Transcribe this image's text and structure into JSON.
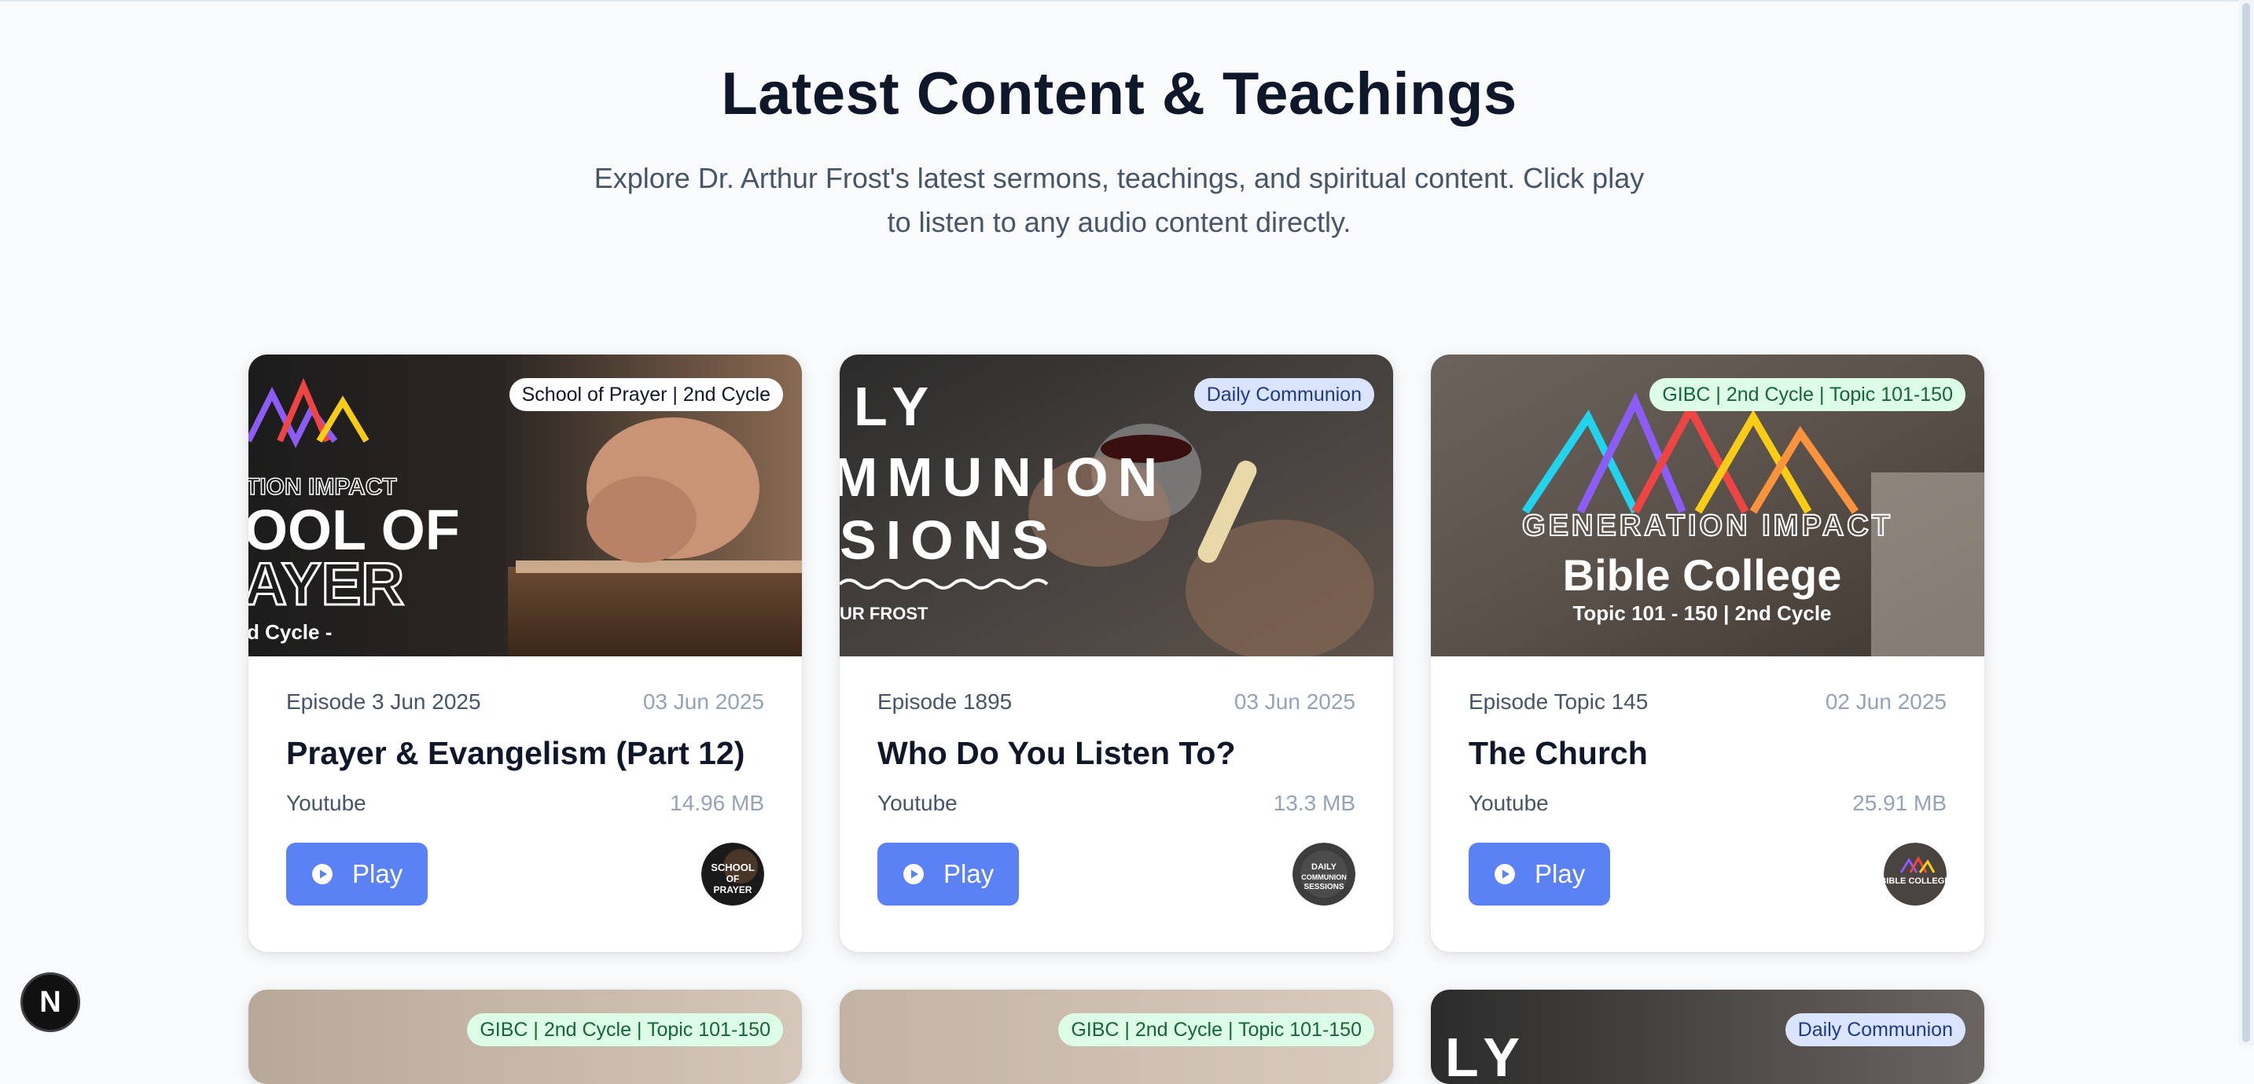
{
  "header": {
    "title": "Latest Content & Teachings",
    "subtitle": "Explore Dr. Arthur Frost's latest sermons, teachings, and spiritual content. Click play to listen to any audio content directly."
  },
  "colors": {
    "play_button": "#5b82f4",
    "tag_school_bg": "#ffffff",
    "tag_communion_bg": "#dbe4ff",
    "tag_communion_text": "#1e3a8a",
    "tag_gibc_bg": "#dcfce7",
    "tag_gibc_text": "#166534"
  },
  "cards": [
    {
      "tag": "School of Prayer | 2nd Cycle",
      "thumb_text": [
        "TION IMPACT",
        "OOL OF",
        "AYER",
        "d Cycle -"
      ],
      "episode": "Episode 3 Jun 2025",
      "date": "03 Jun 2025",
      "title": "Prayer & Evangelism (Part 12)",
      "source": "Youtube",
      "size": "14.96 MB",
      "play_label": "Play",
      "avatar_text": [
        "SCHOOL",
        "OF",
        "PRAYER"
      ]
    },
    {
      "tag": "Daily Communion",
      "thumb_text": [
        "LY",
        "MMUNION",
        "SIONS",
        "UR FROST"
      ],
      "episode": "Episode 1895",
      "date": "03 Jun 2025",
      "title": "Who Do You Listen To?",
      "source": "Youtube",
      "size": "13.3 MB",
      "play_label": "Play",
      "avatar_text": [
        "DAILY",
        "COMMUNION",
        "SESSIONS"
      ]
    },
    {
      "tag": "GIBC | 2nd Cycle | Topic 101-150",
      "thumb_text": [
        "GENERATION IMPACT",
        "Bible College",
        "Topic 101 - 150 | 2nd Cycle"
      ],
      "episode": "Episode Topic 145",
      "date": "02 Jun 2025",
      "title": "The Church",
      "source": "Youtube",
      "size": "25.91 MB",
      "play_label": "Play",
      "avatar_text": [
        "BIBLE COLLEGE"
      ]
    }
  ],
  "next_row_tags": [
    "GIBC | 2nd Cycle | Topic 101-150",
    "GIBC | 2nd Cycle | Topic 101-150",
    "Daily Communion"
  ],
  "next_row_thumb_text": "LY",
  "dev_badge": "N",
  "icons": {
    "play": "play-circle-icon",
    "dev": "nextjs-logo-icon"
  }
}
